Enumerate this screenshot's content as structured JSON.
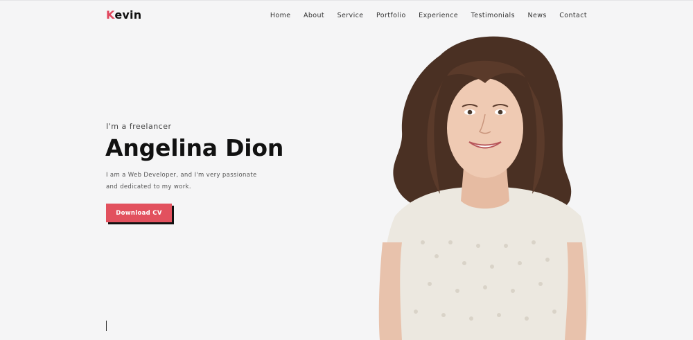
{
  "header": {
    "logo_first": "K",
    "logo_rest": "evin",
    "nav": [
      "Home",
      "About",
      "Service",
      "Portfolio",
      "Experience",
      "Testimonials",
      "News",
      "Contact"
    ]
  },
  "hero": {
    "subtitle": "I'm a freelancer",
    "name": "Angelina Dion",
    "desc_line1": "I am a Web Developer, and I'm very passionate",
    "desc_line2": "and dedicated to my work.",
    "cta_label": "Download CV"
  },
  "colors": {
    "accent": "#e0465d",
    "button": "#e2515e",
    "background": "#f5f5f6"
  },
  "icons": {
    "portrait": "woman-portrait-photo"
  }
}
